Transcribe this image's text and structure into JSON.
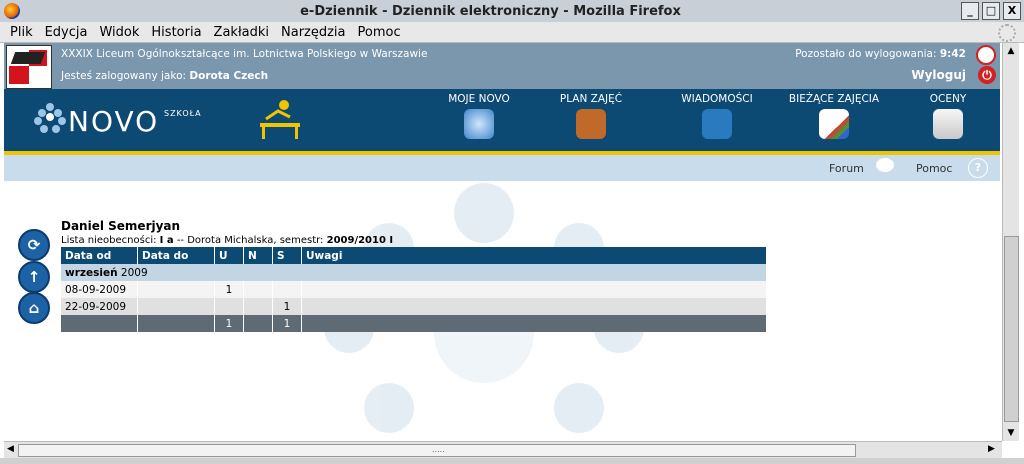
{
  "window": {
    "title": "e-Dziennik - Dziennik elektroniczny - Mozilla Firefox",
    "minimize": "_",
    "maximize": "□",
    "close": "X"
  },
  "menu": [
    "Plik",
    "Edycja",
    "Widok",
    "Historia",
    "Zakładki",
    "Narzędzia",
    "Pomoc"
  ],
  "header": {
    "school": "XXXIX Liceum Ogólnokształcące im. Lotnictwa Polskiego w Warszawie",
    "logged_prefix": "Jesteś zalogowany jako:",
    "logged_user": "Dorota Czech",
    "timeout_prefix": "Pozostało do wylogowania:",
    "timeout_value": "9:42",
    "logout": "Wyloguj"
  },
  "brand": {
    "name": "NOVO",
    "sub": "SZKOŁA"
  },
  "nav": [
    {
      "label": "MOJE NOVO",
      "icon": "globe-icon",
      "color": "#4a8fd0"
    },
    {
      "label": "PLAN ZAJĘĆ",
      "icon": "book-icon",
      "color": "#c06a2a"
    },
    {
      "label": "WIADOMOŚCI",
      "icon": "mail-icon",
      "color": "#2a7ac0"
    },
    {
      "label": "BIEŻĄCE ZAJĘCIA",
      "icon": "chart-icon",
      "color": "#e8e8e8"
    },
    {
      "label": "OCENY",
      "icon": "grades-icon",
      "color": "#e8e8e8"
    }
  ],
  "subnav": {
    "forum": "Forum",
    "help": "Pomoc",
    "help_icon_glyph": "?"
  },
  "sideicons": [
    {
      "name": "refresh-icon",
      "glyph": "⟳"
    },
    {
      "name": "arrow-up-icon",
      "glyph": "↑"
    },
    {
      "name": "home-icon",
      "glyph": "⌂"
    }
  ],
  "student": {
    "name": "Daniel Semerjyan",
    "list_prefix": "Lista nieobecności:",
    "class": "I a",
    "teacher_part": "-- Dorota Michalska, semestr:",
    "semester": "2009/2010 I"
  },
  "table": {
    "headers": [
      "Data od",
      "Data do",
      "U",
      "N",
      "S",
      "Uwagi"
    ],
    "month_bold": "wrzesień",
    "month_year": "2009",
    "rows": [
      {
        "from": "08-09-2009",
        "to": "",
        "u": "1",
        "n": "",
        "s": "",
        "notes": ""
      },
      {
        "from": "22-09-2009",
        "to": "",
        "u": "",
        "n": "",
        "s": "1",
        "notes": ""
      }
    ],
    "totals": {
      "u": "1",
      "n": "",
      "s": "1"
    }
  },
  "scroll": {
    "up": "▲",
    "down": "▼",
    "left": "◀",
    "right": "▶",
    "grip": "....."
  },
  "colors": {
    "navbar": "#0d4a73",
    "accent": "#f1c400",
    "topbar": "#7b97ad",
    "subbar": "#c8dceb"
  }
}
